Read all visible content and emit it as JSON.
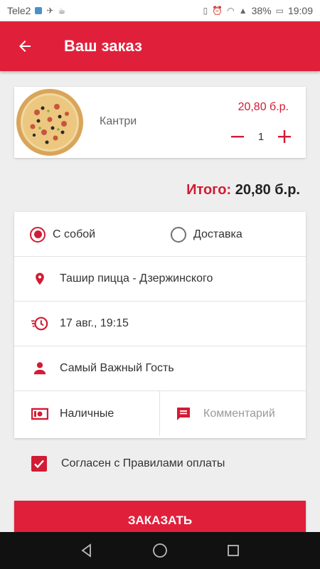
{
  "status_bar": {
    "carrier": "Tele2",
    "battery": "38%",
    "time": "19:09"
  },
  "app_bar": {
    "title": "Ваш заказ",
    "back_icon": "arrow-left-icon"
  },
  "cart": {
    "items": [
      {
        "name": "Кантри",
        "price": "20,80 б.р.",
        "quantity": "1"
      }
    ]
  },
  "total": {
    "label": "Итого:",
    "value": "20,80 б.р."
  },
  "order_form": {
    "delivery_options": [
      {
        "label": "С собой",
        "selected": true
      },
      {
        "label": "Доставка",
        "selected": false
      }
    ],
    "location": "Ташир пицца - Дзержинского",
    "datetime": "17 авг., 19:15",
    "customer": "Самый Важный Гость",
    "payment": "Наличные",
    "comment_placeholder": "Комментарий"
  },
  "agreement": {
    "checked": true,
    "label": "Согласен с Правилами оплаты"
  },
  "order_button": "ЗАКАЗАТЬ",
  "colors": {
    "accent": "#e0203a",
    "accent_dark": "#d21b34"
  }
}
